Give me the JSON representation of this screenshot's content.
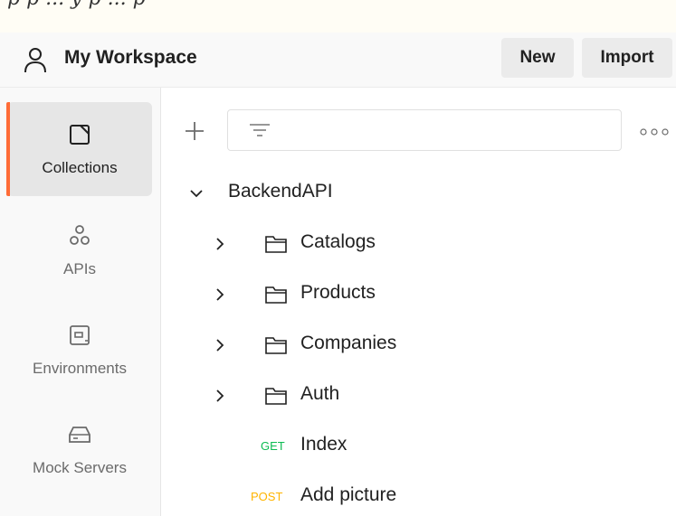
{
  "top_strip": {
    "text": "p p ... y p ... p"
  },
  "header": {
    "workspace_name": "My Workspace",
    "new_label": "New",
    "import_label": "Import"
  },
  "sidebar": {
    "items": [
      {
        "label": "Collections",
        "icon": "collection-icon",
        "active": true
      },
      {
        "label": "APIs",
        "icon": "apis-icon",
        "active": false
      },
      {
        "label": "Environments",
        "icon": "environments-icon",
        "active": false
      },
      {
        "label": "Mock Servers",
        "icon": "mock-servers-icon",
        "active": false
      }
    ]
  },
  "collection": {
    "name": "BackendAPI",
    "folders": [
      {
        "name": "Catalogs"
      },
      {
        "name": "Products"
      },
      {
        "name": "Companies"
      },
      {
        "name": "Auth"
      }
    ],
    "requests": [
      {
        "method": "GET",
        "name": "Index"
      },
      {
        "method": "POST",
        "name": "Add picture"
      }
    ]
  },
  "colors": {
    "accent": "#ff6c37",
    "get": "#0cbb52",
    "post": "#ffb400"
  }
}
